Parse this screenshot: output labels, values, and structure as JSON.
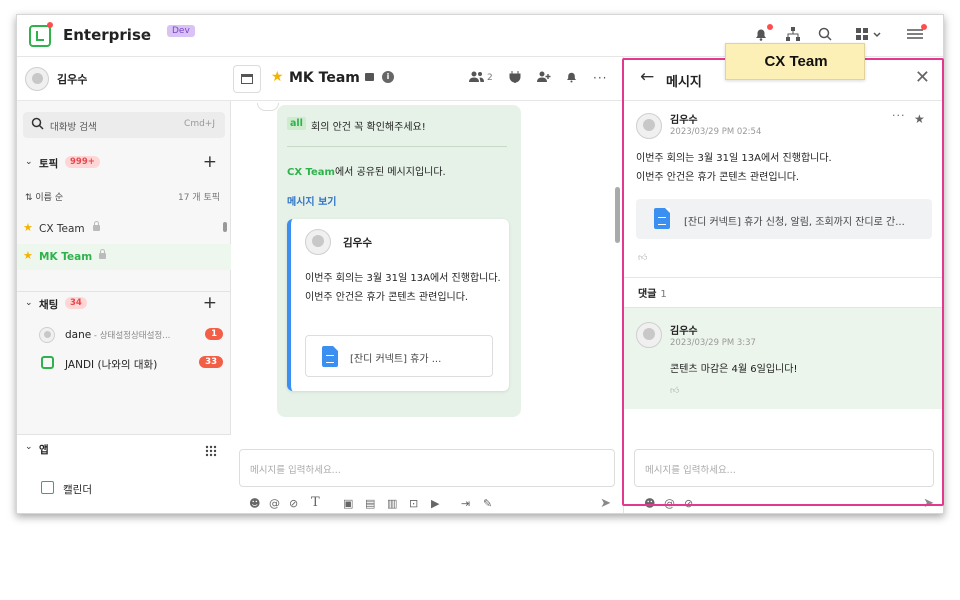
{
  "topbar": {
    "brand": "Enterprise",
    "env_badge": "Dev"
  },
  "sidebar": {
    "user_name": "김우수",
    "search_placeholder": "대화방 검색",
    "search_shortcut": "Cmd+J",
    "topics": {
      "label": "토픽",
      "count": "999+",
      "sort_label": "이름 순",
      "total": "17 개 토픽",
      "items": [
        {
          "label": "CX Team",
          "starred": true,
          "locked": true,
          "active": false
        },
        {
          "label": "MK Team",
          "starred": true,
          "locked": true,
          "active": true
        }
      ]
    },
    "chats": {
      "label": "채팅",
      "count": "34",
      "items": [
        {
          "name": "dane",
          "status": " - 상태설정상태설정...",
          "badge": "1"
        },
        {
          "name": "JANDI (나와의 대화)",
          "badge": "33"
        }
      ]
    },
    "apps": {
      "label": "앱",
      "items": [
        {
          "label": "캘린더"
        }
      ]
    }
  },
  "main": {
    "title": "MK Team",
    "member_count": "2",
    "message": {
      "mention": "all",
      "text": "회의 안건 꼭 확인해주세요!",
      "shared_from": "CX Team",
      "shared_suffix": "에서 공유된 메시지입니다.",
      "view_link": "메시지 보기",
      "quote": {
        "author": "김우수",
        "body_line1": "이번주 회의는 3월 31일 13A에서 진행합니다.",
        "body_line2": "이번주 안건은 휴가 콘텐츠 관련입니다.",
        "file_name": "[잔디 커넥트] 휴가 ..."
      }
    },
    "composer_placeholder": "메시지를 입력하세요..."
  },
  "thread": {
    "title": "메시지",
    "post": {
      "author": "김우수",
      "time": "2023/03/29 PM 02:54",
      "body_line1": "이번주 회의는 3월 31일 13A에서 진행합니다.",
      "body_line2": "이번주 안건은 휴가 콘텐츠 관련입니다.",
      "file_name": "[잔디 커넥트] 휴가 신청, 알림, 조회까지 잔디로 간..."
    },
    "comments_label": "댓글",
    "comments_count": "1",
    "comment": {
      "author": "김우수",
      "time": "2023/03/29 PM 3:37",
      "text": "콘텐츠 마감은 4월 6일입니다!"
    },
    "composer_placeholder": "메시지를 입력하세요..."
  },
  "callout": {
    "text": "CX Team"
  },
  "colors": {
    "brand_green": "#2fb24c",
    "highlight_pink": "#e4388f",
    "callout_yellow": "#fdf0b7",
    "badge_red": "#f25e46"
  }
}
